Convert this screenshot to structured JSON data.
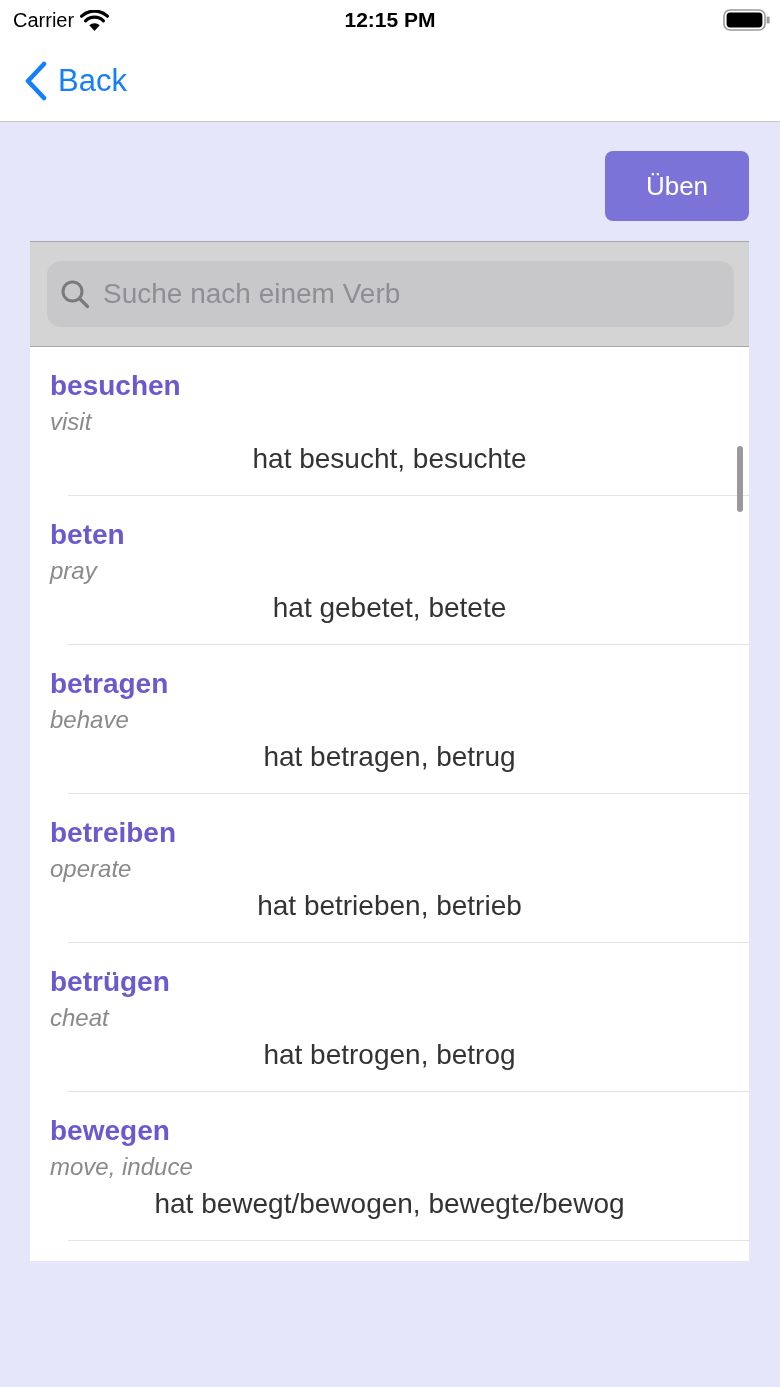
{
  "status_bar": {
    "carrier": "Carrier",
    "time": "12:15 PM"
  },
  "nav_bar": {
    "back_label": "Back"
  },
  "practice_button": {
    "label": "Üben"
  },
  "search": {
    "placeholder": "Suche nach einem Verb"
  },
  "verbs": [
    {
      "verb": "besuchen",
      "translation": "visit",
      "forms": "hat besucht, besuchte"
    },
    {
      "verb": "beten",
      "translation": "pray",
      "forms": "hat gebetet, betete"
    },
    {
      "verb": "betragen",
      "translation": "behave",
      "forms": "hat betragen, betrug"
    },
    {
      "verb": "betreiben",
      "translation": "operate",
      "forms": "hat betrieben, betrieb"
    },
    {
      "verb": "betrügen",
      "translation": "cheat",
      "forms": "hat betrogen, betrog"
    },
    {
      "verb": "bewegen",
      "translation": "move, induce",
      "forms": "hat bewegt/bewogen, bewegte/bewog"
    }
  ]
}
